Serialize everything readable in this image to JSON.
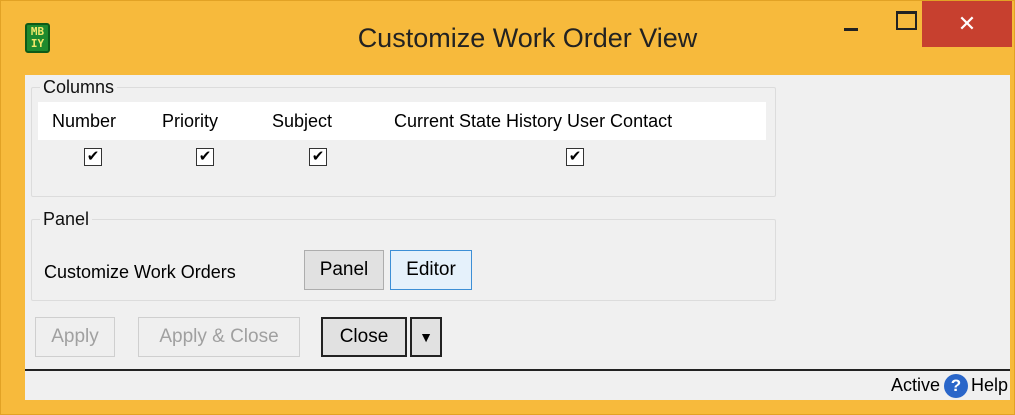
{
  "window": {
    "title": "Customize Work Order View",
    "icon_text_top": "MB",
    "icon_text_bottom": "IY",
    "close_glyph": "✕"
  },
  "columns_group": {
    "title": "Columns",
    "headers": [
      "Number",
      "Priority",
      "Subject",
      "Current State History User Contact"
    ],
    "checked": [
      true,
      true,
      true,
      true
    ],
    "check_glyph": "✔"
  },
  "panel_group": {
    "title": "Panel",
    "label": "Customize Work Orders",
    "panel_button": "Panel",
    "editor_button": "Editor"
  },
  "actions": {
    "apply": "Apply",
    "apply_close": "Apply & Close",
    "close": "Close",
    "dropdown_glyph": "▼"
  },
  "status": {
    "state": "Active",
    "help_glyph": "?",
    "help": "Help"
  }
}
